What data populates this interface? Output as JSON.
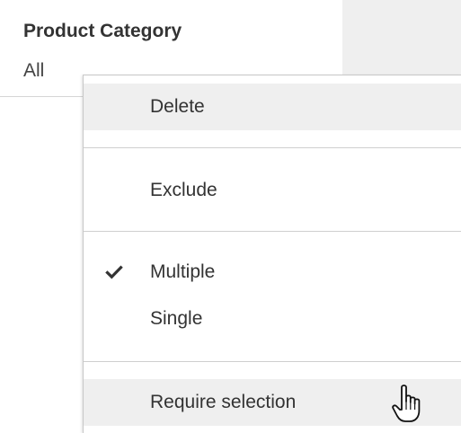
{
  "filter": {
    "title": "Product Category",
    "value": "All"
  },
  "menu": {
    "delete_label": "Delete",
    "exclude_label": "Exclude",
    "multiple_label": "Multiple",
    "single_label": "Single",
    "require_selection_label": "Require selection",
    "multiple_checked": true
  },
  "colors": {
    "menu_hover_bg": "#efefef",
    "divider": "#cfcfcf",
    "side_panel_bg": "#efefef"
  },
  "icons": {
    "check": "check-icon",
    "cursor": "hand-pointer-icon"
  }
}
